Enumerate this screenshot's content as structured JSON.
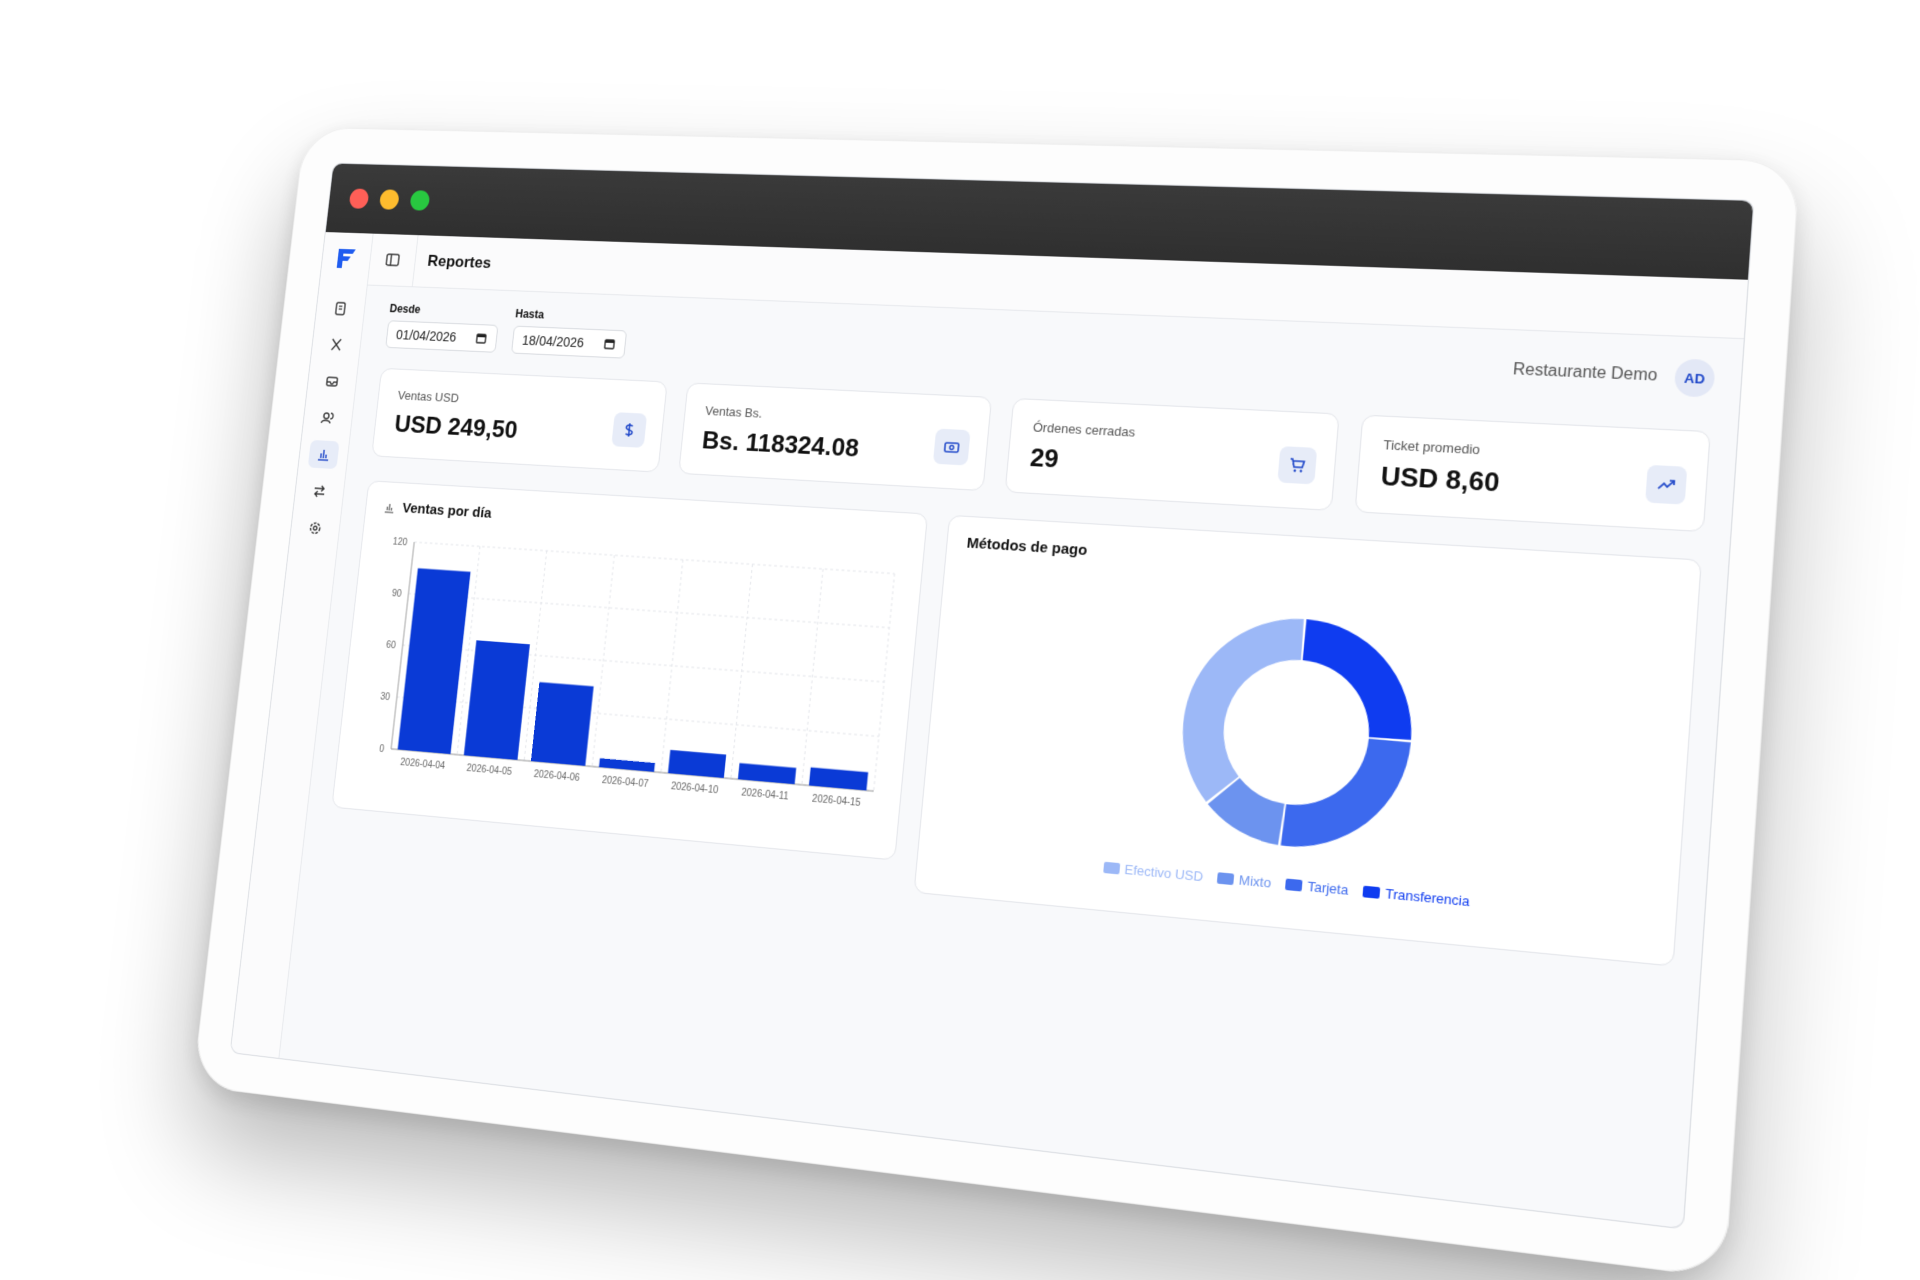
{
  "window": {
    "controls": {
      "close_color": "#ff5f57",
      "minimize_color": "#febc2e",
      "maximize_color": "#28c840"
    }
  },
  "topbar": {
    "title": "Reportes",
    "logo_icon": "brand-f-logo",
    "toggle_icon": "sidebar-toggle-icon"
  },
  "sidebar": {
    "items": [
      {
        "icon": "clipboard-icon",
        "active": false
      },
      {
        "icon": "utensils-icon",
        "active": false
      },
      {
        "icon": "inbox-icon",
        "active": false
      },
      {
        "icon": "users-icon",
        "active": false
      },
      {
        "icon": "bar-chart-icon",
        "active": true
      },
      {
        "icon": "transfer-icon",
        "active": false
      },
      {
        "icon": "gear-icon",
        "active": false
      }
    ]
  },
  "filters": {
    "desde": {
      "label": "Desde",
      "value": "01/04/2026"
    },
    "hasta": {
      "label": "Hasta",
      "value": "18/04/2026"
    }
  },
  "user": {
    "restaurant": "Restaurante Demo",
    "initials": "AD"
  },
  "stats": [
    {
      "label": "Ventas USD",
      "value": "USD 249,50",
      "icon": "dollar-icon"
    },
    {
      "label": "Ventas Bs.",
      "value": "Bs. 118324.08",
      "icon": "banknote-icon"
    },
    {
      "label": "Órdenes cerradas",
      "value": "29",
      "icon": "cart-icon"
    },
    {
      "label": "Ticket promedio",
      "value": "USD 8,60",
      "icon": "trending-up-icon"
    }
  ],
  "colors": {
    "accent": "#0a3ad6",
    "icon_bg": "#e7ecf8",
    "grid": "#e3e5ea"
  },
  "chart_data": [
    {
      "type": "bar",
      "title": "Ventas por día",
      "categories": [
        "2026-04-04",
        "2026-04-05",
        "2026-04-06",
        "2026-04-07",
        "2026-04-10",
        "2026-04-11",
        "2026-04-15"
      ],
      "values": [
        105,
        66,
        45,
        5,
        13,
        9,
        10
      ],
      "ylim": [
        0,
        120
      ],
      "yticks": [
        "0",
        "30",
        "60",
        "90",
        "120"
      ],
      "grid": true,
      "color": "#0a3ad6"
    },
    {
      "type": "pie",
      "title": "Métodos de pago",
      "labels": [
        "Efectivo USD",
        "Mixto",
        "Tarjeta",
        "Transferencia"
      ],
      "values": [
        0.37,
        0.12,
        0.26,
        0.25
      ],
      "colors": [
        "#9cb8f7",
        "#6c93ef",
        "#3c69ee",
        "#0f3cf0"
      ],
      "legend": "bottom",
      "donut": true
    }
  ]
}
